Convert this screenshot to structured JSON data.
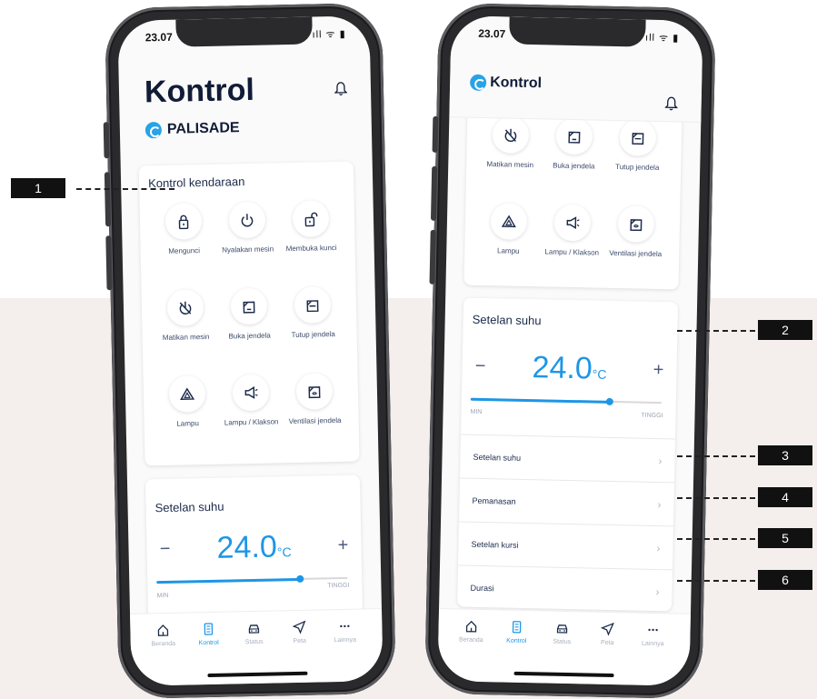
{
  "phone_left": {
    "status_time": "23.07",
    "status_icons": "ıll ᯤ ▮",
    "page_title": "Kontrol",
    "brand": "PALISADE",
    "vehicle_control": {
      "title": "Kontrol kendaraan",
      "items": [
        {
          "label": "Mengunci",
          "icon": "lock-icon"
        },
        {
          "label": "Nyalakan mesin",
          "icon": "power-icon"
        },
        {
          "label": "Membuka kunci",
          "icon": "unlock-icon"
        },
        {
          "label": "Matikan mesin",
          "icon": "power-off-icon"
        },
        {
          "label": "Buka jendela",
          "icon": "window-open-icon"
        },
        {
          "label": "Tutup jendela",
          "icon": "window-close-icon"
        },
        {
          "label": "Lampu",
          "icon": "hazard-icon"
        },
        {
          "label": "Lampu / Klakson",
          "icon": "horn-icon"
        },
        {
          "label": "Ventilasi jendela",
          "icon": "window-vent-icon"
        }
      ]
    },
    "temperature": {
      "title": "Setelan suhu",
      "minus": "−",
      "plus": "+",
      "value": "24.0",
      "unit": "°C",
      "min_label": "MIN",
      "max_label": "TINGGI",
      "level": 0.75
    },
    "tabs": [
      {
        "label": "Beranda",
        "icon": "home-icon",
        "active": false
      },
      {
        "label": "Kontrol",
        "icon": "remote-icon",
        "active": true
      },
      {
        "label": "Status",
        "icon": "car-icon",
        "active": false
      },
      {
        "label": "Peta",
        "icon": "navigation-icon",
        "active": false
      },
      {
        "label": "Lainnya",
        "icon": "more-icon",
        "active": false
      }
    ]
  },
  "phone_right": {
    "status_time": "23.07",
    "status_icons": "ıll ᯤ ▮",
    "page_title": "Kontrol",
    "vehicle_control": {
      "items": [
        {
          "label": "Matikan mesin",
          "icon": "power-off-icon"
        },
        {
          "label": "Buka jendela",
          "icon": "window-open-icon"
        },
        {
          "label": "Tutup jendela",
          "icon": "window-close-icon"
        },
        {
          "label": "Lampu",
          "icon": "hazard-icon"
        },
        {
          "label": "Lampu / Klakson",
          "icon": "horn-icon"
        },
        {
          "label": "Ventilasi jendela",
          "icon": "window-vent-icon"
        }
      ]
    },
    "temperature": {
      "title": "Setelan suhu",
      "minus": "−",
      "plus": "+",
      "value": "24.0",
      "unit": "°C",
      "min_label": "MIN",
      "max_label": "TINGGI",
      "level": 0.73
    },
    "settings": [
      {
        "label": "Setelan suhu"
      },
      {
        "label": "Pemanasan"
      },
      {
        "label": "Setelan kursi"
      },
      {
        "label": "Durasi"
      }
    ],
    "tabs": [
      {
        "label": "Beranda",
        "icon": "home-icon",
        "active": false
      },
      {
        "label": "Kontrol",
        "icon": "remote-icon",
        "active": true
      },
      {
        "label": "Status",
        "icon": "car-icon",
        "active": false
      },
      {
        "label": "Peta",
        "icon": "navigation-icon",
        "active": false
      },
      {
        "label": "Lainnya",
        "icon": "more-icon",
        "active": false
      }
    ]
  },
  "callouts": [
    "1",
    "2",
    "3",
    "4",
    "5",
    "6"
  ],
  "colors": {
    "accent": "#1e96e6",
    "background_band": "#f4eeec",
    "text_dark": "#111c36"
  }
}
